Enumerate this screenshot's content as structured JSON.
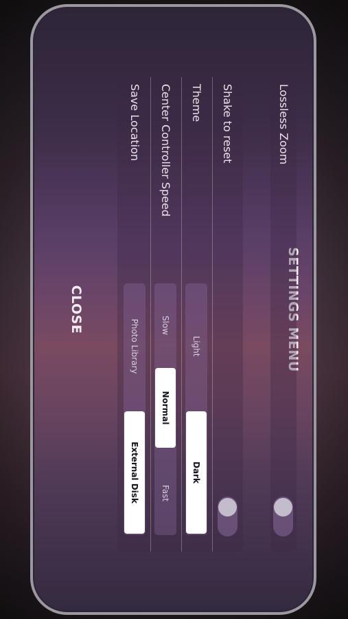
{
  "title": "SETTINGS MENU",
  "close_label": "CLOSE",
  "settings": {
    "lossless_zoom": {
      "label": "Lossless Zoom",
      "enabled": false
    },
    "shake_to_reset": {
      "label": "Shake to reset",
      "enabled": false
    },
    "theme": {
      "label": "Theme",
      "options": [
        "Light",
        "Dark"
      ],
      "selected": "Dark"
    },
    "controller_speed": {
      "label": "Center Controller Speed",
      "options": [
        "Slow",
        "Normal",
        "Fast"
      ],
      "selected": "Normal"
    },
    "save_location": {
      "label": "Save Location",
      "options": [
        "Photo Library",
        "External Disk"
      ],
      "selected": "External Disk"
    }
  }
}
